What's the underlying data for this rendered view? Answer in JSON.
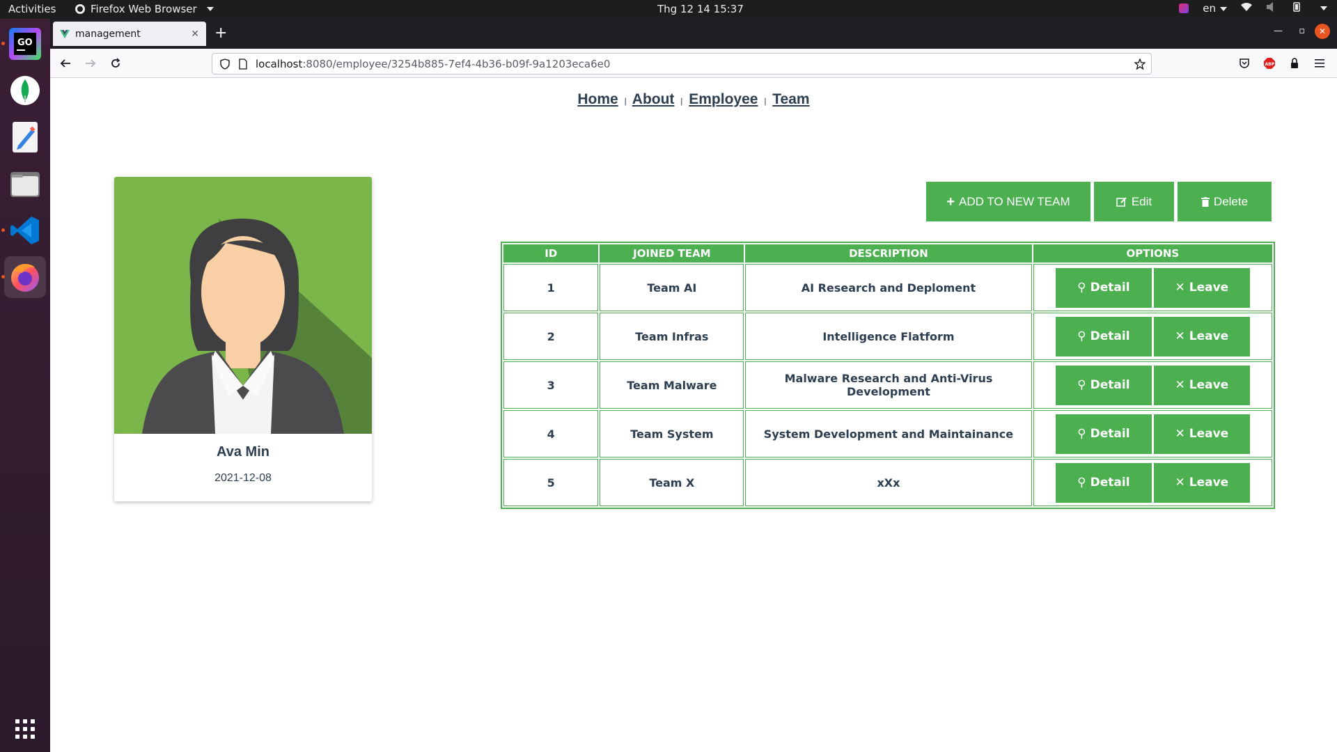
{
  "topbar": {
    "activities": "Activities",
    "app_name": "Firefox Web Browser",
    "clock": "Thg 12 14  15:37",
    "input_lang": "en"
  },
  "browser": {
    "tab_title": "management",
    "url_host": "localhost",
    "url_path": ":8080/employee/3254b885-7ef4-4b36-b09f-9a1203eca6e0"
  },
  "nav": {
    "home": "Home",
    "about": "About",
    "employee": "Employee",
    "team": "Team",
    "sep": "|"
  },
  "profile": {
    "name": "Ava Min",
    "date": "2021-12-08"
  },
  "actions": {
    "add_team": "ADD TO NEW TEAM",
    "edit": "Edit",
    "delete": "Delete"
  },
  "table": {
    "headers": [
      "ID",
      "JOINED TEAM",
      "DESCRIPTION",
      "OPTIONS"
    ],
    "detail_label": "Detail",
    "leave_label": "Leave",
    "rows": [
      {
        "id": "1",
        "team": "Team AI",
        "description": "AI Research and Deploment"
      },
      {
        "id": "2",
        "team": "Team Infras",
        "description": "Intelligence Flatform"
      },
      {
        "id": "3",
        "team": "Team Malware",
        "description": "Malware Research and Anti-Virus Development"
      },
      {
        "id": "4",
        "team": "Team System",
        "description": "System Development and Maintainance"
      },
      {
        "id": "5",
        "team": "Team X",
        "description": "xXx"
      }
    ]
  },
  "colors": {
    "accent": "#4caf50",
    "text": "#2c3e50"
  }
}
